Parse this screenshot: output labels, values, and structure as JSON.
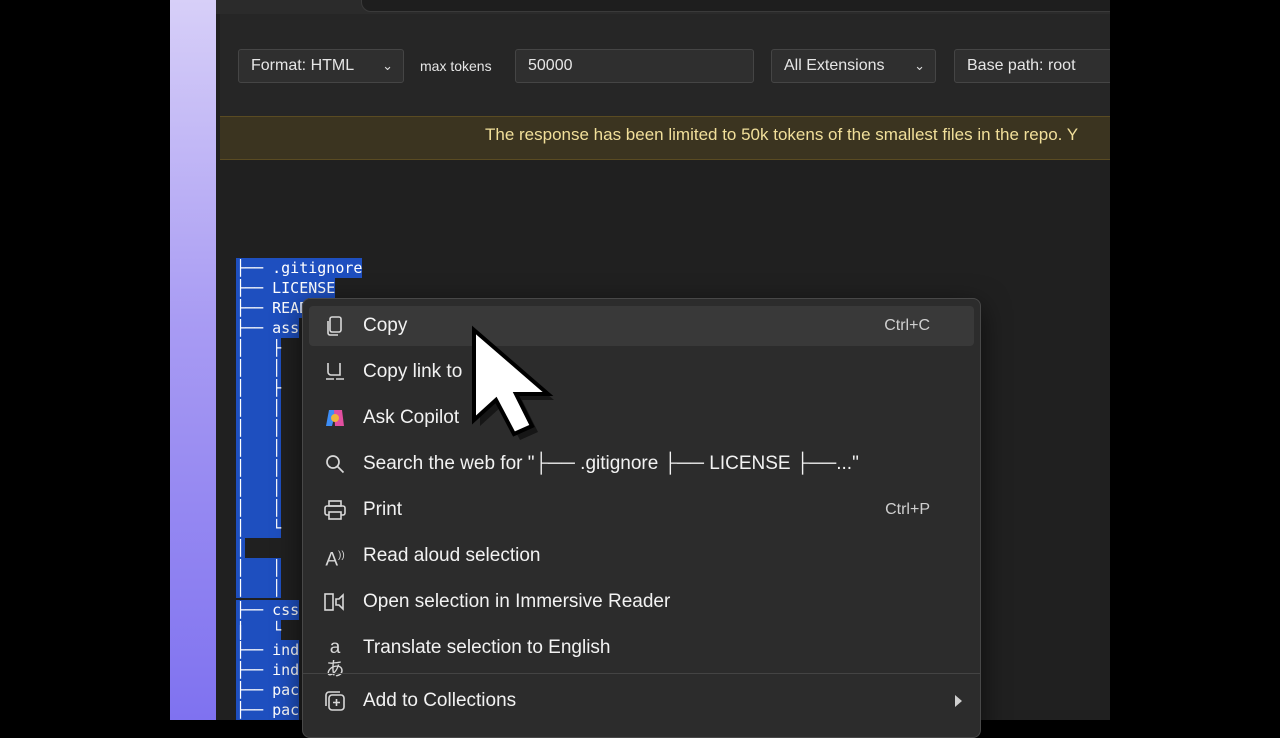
{
  "toolbar": {
    "format_label": "Format: HTML",
    "max_tokens_label": "max tokens",
    "max_tokens_value": "50000",
    "extensions_label": "All Extensions",
    "base_path_label": "Base path: root"
  },
  "notice": {
    "text": "The response has been limited to 50k tokens of the smallest files in the repo. Y"
  },
  "code_lines": [
    "├── .gitignore",
    "├── LICENSE",
    "├── READ",
    "├── ass",
    "│   ├",
    "│   │",
    "│   ├",
    "│   │",
    "│   │",
    "│   │",
    "│   │",
    "│   │",
    "│   │",
    "│   └",
    "│",
    "│   │",
    "│   │",
    "├── css",
    "│   └",
    "│",
    "├── ind",
    "├── ind",
    "├── pac",
    "├── pac"
  ],
  "context_menu": {
    "items": [
      {
        "label": "Copy",
        "shortcut": "Ctrl+C",
        "icon": "copy-icon"
      },
      {
        "label": "Copy link to",
        "shortcut": "",
        "icon": "link-highlight-icon"
      },
      {
        "label": "Ask Copilot",
        "shortcut": "",
        "icon": "copilot-icon"
      },
      {
        "label": "Search the web for \"├── .gitignore ├── LICENSE ├──...\"",
        "shortcut": "",
        "icon": "search-icon"
      },
      {
        "label": "Print",
        "shortcut": "Ctrl+P",
        "icon": "printer-icon"
      },
      {
        "label": "Read aloud selection",
        "shortcut": "",
        "icon": "read-aloud-icon"
      },
      {
        "label": "Open selection in Immersive Reader",
        "shortcut": "",
        "icon": "immersive-reader-icon"
      },
      {
        "label": "Translate selection to English",
        "shortcut": "",
        "icon": "translate-icon"
      },
      {
        "label": "Add to Collections",
        "shortcut": "",
        "icon": "collections-icon"
      }
    ]
  },
  "colors": {
    "selection": "#1e4fbf",
    "menu_bg": "#2c2c2c",
    "notice_text": "#f1df9a"
  }
}
